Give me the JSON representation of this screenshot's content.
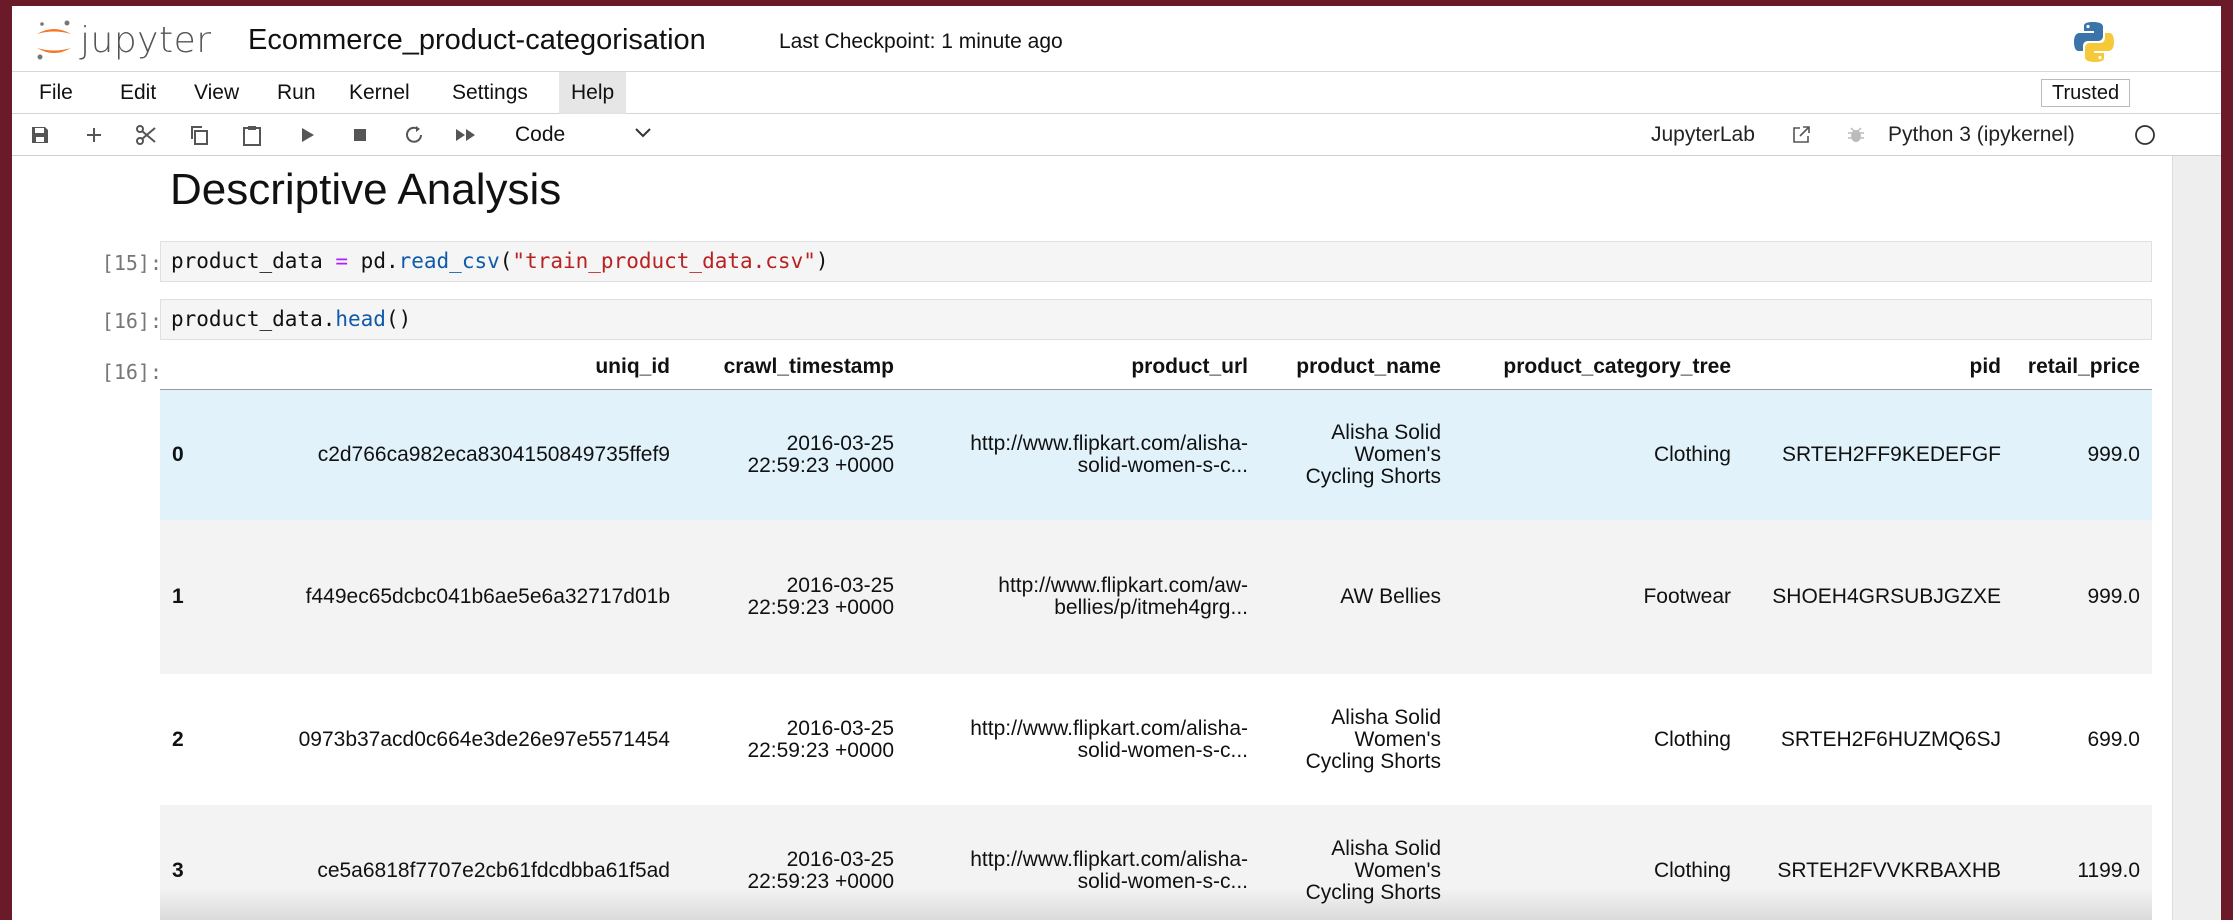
{
  "app": {
    "logo_text": "jupyter",
    "notebook_title": "Ecommerce_product-categorisation",
    "checkpoint": "Last Checkpoint: 1 minute ago"
  },
  "menu": {
    "items": [
      "File",
      "Edit",
      "View",
      "Run",
      "Kernel",
      "Settings",
      "Help"
    ],
    "active": "Help",
    "trusted": "Trusted"
  },
  "toolbar": {
    "icons": [
      "save-icon",
      "add-cell-icon",
      "cut-icon",
      "copy-icon",
      "paste-icon",
      "run-icon",
      "stop-icon",
      "restart-icon",
      "fast-forward-icon"
    ],
    "cell_type": "Code",
    "jupyterlab": "JupyterLab",
    "kernel": "Python 3 (ipykernel)"
  },
  "notebook": {
    "heading": "Descriptive Analysis",
    "cells": [
      {
        "prompt": "[15]:",
        "code": "product_data = pd.read_csv(\"train_product_data.csv\")"
      },
      {
        "prompt": "[16]:",
        "code": "product_data.head()"
      }
    ],
    "output_prompt": "[16]:",
    "table": {
      "columns": [
        "",
        "uniq_id",
        "crawl_timestamp",
        "product_url",
        "product_name",
        "product_category_tree",
        "pid",
        "retail_price"
      ],
      "rows": [
        [
          "0",
          "c2d766ca982eca8304150849735ffef9",
          [
            "2016-03-25",
            "22:59:23 +0000"
          ],
          [
            "http://www.flipkart.com/alisha-",
            "solid-women-s-c..."
          ],
          [
            "Alisha Solid",
            "Women's",
            "Cycling Shorts"
          ],
          "Clothing",
          "SRTEH2FF9KEDEFGF",
          "999.0"
        ],
        [
          "1",
          "f449ec65dcbc041b6ae5e6a32717d01b",
          [
            "2016-03-25",
            "22:59:23 +0000"
          ],
          [
            "http://www.flipkart.com/aw-",
            "bellies/p/itmeh4grg..."
          ],
          [
            "AW Bellies"
          ],
          "Footwear",
          "SHOEH4GRSUBJGZXE",
          "999.0"
        ],
        [
          "2",
          "0973b37acd0c664e3de26e97e5571454",
          [
            "2016-03-25",
            "22:59:23 +0000"
          ],
          [
            "http://www.flipkart.com/alisha-",
            "solid-women-s-c..."
          ],
          [
            "Alisha Solid",
            "Women's",
            "Cycling Shorts"
          ],
          "Clothing",
          "SRTEH2F6HUZMQ6SJ",
          "699.0"
        ],
        [
          "3",
          "ce5a6818f7707e2cb61fdcdbba61f5ad",
          [
            "2016-03-25",
            "22:59:23 +0000"
          ],
          [
            "http://www.flipkart.com/alisha-",
            "solid-women-s-c..."
          ],
          [
            "Alisha Solid",
            "Women's",
            "Cycling Shorts"
          ],
          "Clothing",
          "SRTEH2FVVKRBAXHB",
          "1199.0"
        ]
      ]
    }
  },
  "colors": {
    "jupyter_orange": "#f37726",
    "selected_row": "#e1f2fb",
    "string_red": "#ba2121",
    "function_blue": "#0f5aaa",
    "operator_purple": "#aa22ff"
  }
}
